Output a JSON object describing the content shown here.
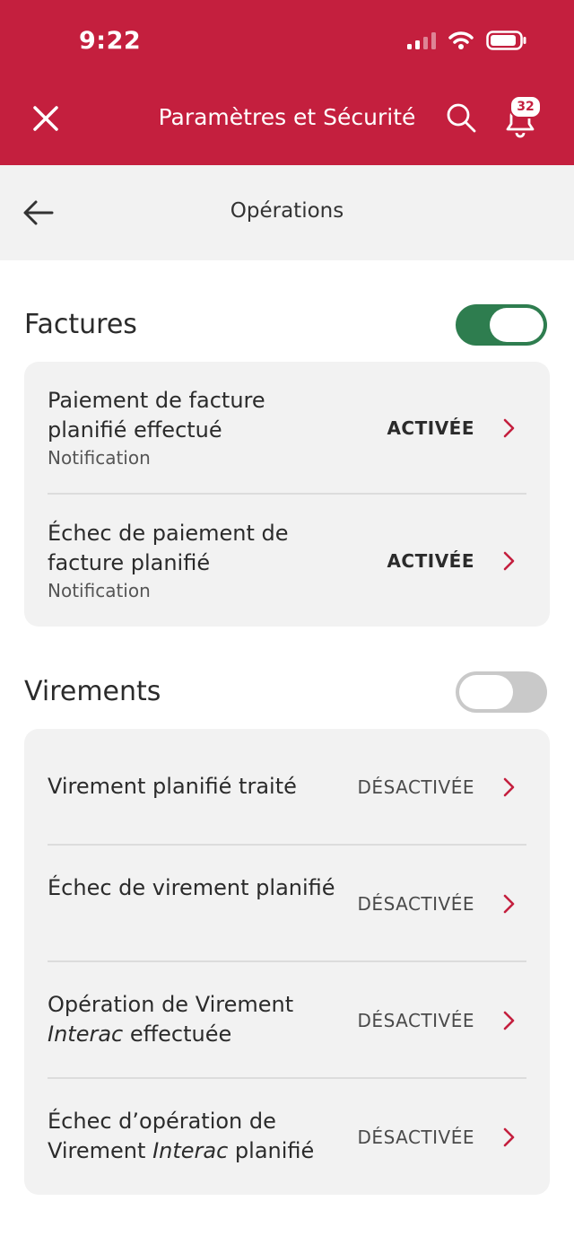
{
  "status_bar": {
    "time": "9:22"
  },
  "header": {
    "title": "Paramètres et Sécurité",
    "notification_count": "32"
  },
  "subheader": {
    "title": "Opérations"
  },
  "sections": {
    "factures": {
      "title": "Factures",
      "toggle_on": true,
      "rows": [
        {
          "title": "Paiement de facture planifié effectué",
          "subtitle": "Notification",
          "status": "ACTIVÉE"
        },
        {
          "title": "Échec de paiement de facture planifié",
          "subtitle": "Notification",
          "status": "ACTIVÉE"
        }
      ]
    },
    "virements": {
      "title": "Virements",
      "toggle_on": false,
      "rows": [
        {
          "title": "Virement planifié traité",
          "status": "DÉSACTIVÉE"
        },
        {
          "title": "Échec de virement planifié",
          "status": "DÉSACTIVÉE"
        },
        {
          "title_pre": "Opération de Virement ",
          "title_em": "Interac",
          "title_post": " effectuée",
          "status": "DÉSACTIVÉE"
        },
        {
          "title_pre": "Échec d’opération de Virement ",
          "title_em": "Interac",
          "title_post": " planifié",
          "status": "DÉSACTIVÉE"
        }
      ]
    }
  },
  "colors": {
    "brand_red": "#c41f3e",
    "toggle_on_green": "#2e7d4f",
    "chevron_red": "#c41f3e"
  }
}
